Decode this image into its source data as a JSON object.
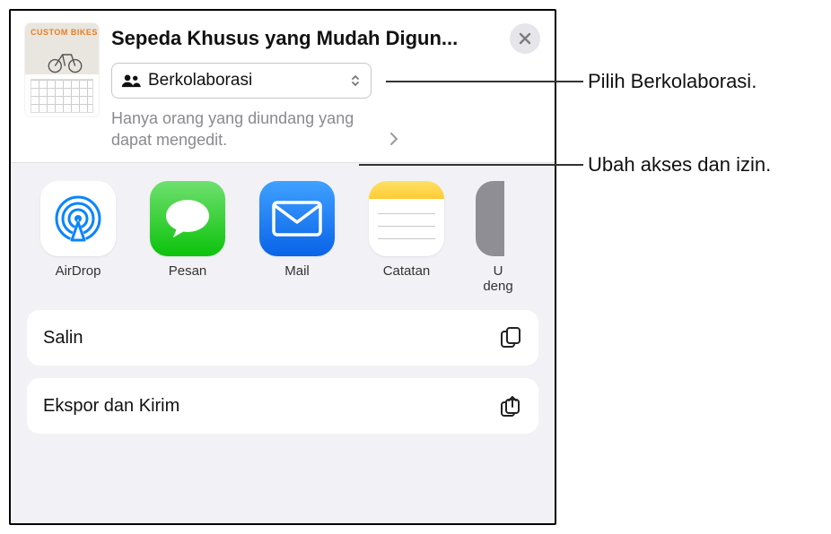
{
  "header": {
    "title": "Sepeda Khusus yang Mudah Digun...",
    "collab_label": "Berkolaborasi",
    "permission_text": "Hanya orang yang diundang yang dapat mengedit.",
    "thumb_tag": "CUSTOM\nBIKES"
  },
  "apps": [
    {
      "id": "airdrop",
      "label": "AirDrop"
    },
    {
      "id": "messages",
      "label": "Pesan"
    },
    {
      "id": "mail",
      "label": "Mail"
    },
    {
      "id": "notes",
      "label": "Catatan"
    }
  ],
  "partial_app_label": "U\ndeng",
  "actions": {
    "copy": "Salin",
    "export": "Ekspor dan Kirim"
  },
  "callouts": {
    "collab": "Pilih Berkolaborasi.",
    "permission": "Ubah akses dan izin."
  }
}
